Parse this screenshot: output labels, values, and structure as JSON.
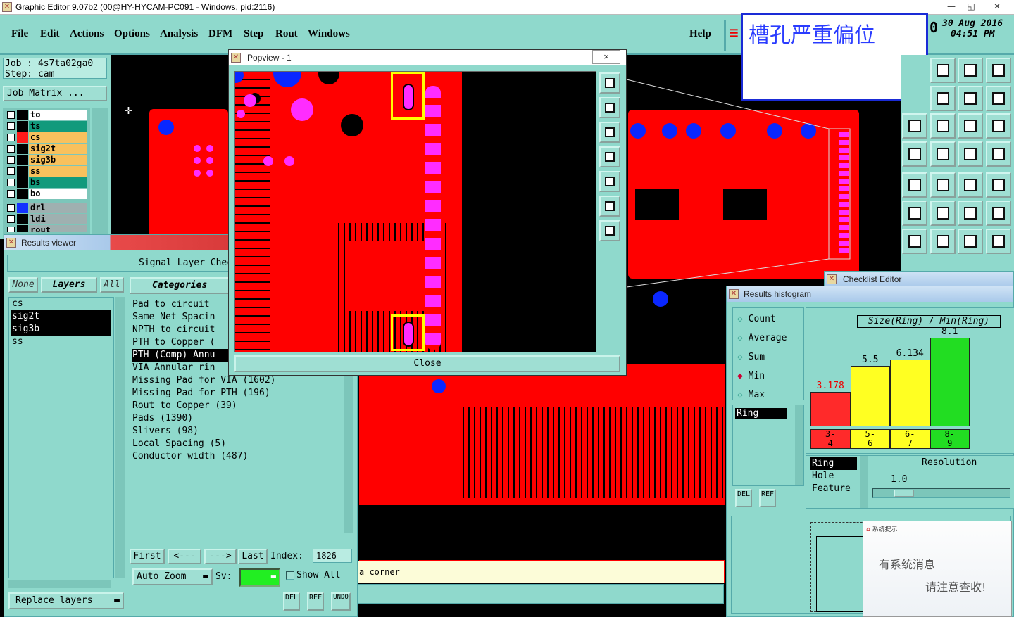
{
  "window": {
    "title": "Graphic Editor 9.07b2 (00@HY-HYCAM-PC091 - Windows, pid:2116)",
    "minimize": "—",
    "restore": "◱",
    "close": "✕"
  },
  "menu": [
    "File",
    "Edit",
    "Actions",
    "Options",
    "Analysis",
    "DFM",
    "Step",
    "Rout",
    "Windows"
  ],
  "help": "Help",
  "datetime": {
    "date": "30 Aug 2016",
    "time": "04:51 PM",
    "prefix": "0"
  },
  "annotation": {
    "text": "槽孔严重偏位"
  },
  "job": {
    "job_label": "Job : 4s7ta02ga0",
    "step_label": "Step: cam",
    "matrix_button": "Job Matrix ..."
  },
  "layers": [
    {
      "name": "to",
      "color": "#ffffff",
      "swatch": "#000000"
    },
    {
      "name": "ts",
      "color": "#129a7c",
      "swatch": "#000000"
    },
    {
      "name": "cs",
      "color": "#f8c15d",
      "swatch": "#ff1a1a"
    },
    {
      "name": "sig2t",
      "color": "#f8c15d",
      "swatch": "#000000"
    },
    {
      "name": "sig3b",
      "color": "#f8c15d",
      "swatch": "#000000"
    },
    {
      "name": "ss",
      "color": "#f8c15d",
      "swatch": "#000000"
    },
    {
      "name": "bs",
      "color": "#129a7c",
      "swatch": "#000000"
    },
    {
      "name": "bo",
      "color": "#ffffff",
      "swatch": "#000000"
    },
    {
      "name": "drl",
      "color": "#9fb0b0",
      "swatch": "#1432ff"
    },
    {
      "name": "ldi",
      "color": "#9fb0b0",
      "swatch": "#000000"
    },
    {
      "name": "rout",
      "color": "#9fb0b0",
      "swatch": "#000000"
    }
  ],
  "results_viewer": {
    "title": "Results viewer",
    "header": "Signal Layer Checks",
    "none_btn": "None",
    "layers_btn": "Layers",
    "all_btn": "All",
    "categories_label": "Categories",
    "layer_list": [
      {
        "name": "cs",
        "selected": false
      },
      {
        "name": "sig2t",
        "selected": true
      },
      {
        "name": "sig3b",
        "selected": true
      },
      {
        "name": "ss",
        "selected": false
      }
    ],
    "categories": [
      {
        "text": "Pad to circuit",
        "selected": false
      },
      {
        "text": "Same Net Spacin",
        "selected": false
      },
      {
        "text": "NPTH to circuit",
        "selected": false
      },
      {
        "text": "PTH to Copper (",
        "selected": false
      },
      {
        "text": "PTH (Comp) Annu",
        "selected": true
      },
      {
        "text": "VIA Annular rin",
        "selected": false
      },
      {
        "text": "Missing Pad for VIA (1602)",
        "selected": false
      },
      {
        "text": "Missing Pad for PTH (196)",
        "selected": false
      },
      {
        "text": "Rout to Copper (39)",
        "selected": false
      },
      {
        "text": "Pads (1390)",
        "selected": false
      },
      {
        "text": "Slivers (98)",
        "selected": false
      },
      {
        "text": "Local Spacing (5)",
        "selected": false
      },
      {
        "text": "Conductor width (487)",
        "selected": false
      }
    ],
    "first_btn": "First",
    "prev_btn": "<---",
    "next_btn": "--->",
    "last_btn": "Last",
    "index_label": "Index:",
    "index_value": "1826",
    "zoom_option": "Auto Zoom",
    "sv_label": "Sv:",
    "show_all": "Show All",
    "replace_layers": "Replace layers",
    "del": "DEL",
    "ref": "REF",
    "undo": "UNDO"
  },
  "popview": {
    "title": "Popview - 1",
    "close_btn": "Close",
    "close_x": "×"
  },
  "status": {
    "text": "a corner"
  },
  "checklist": {
    "title": "Checklist Editor"
  },
  "histogram": {
    "title": "Results histogram",
    "options": [
      {
        "label": "Count",
        "selected": false
      },
      {
        "label": "Average",
        "selected": false
      },
      {
        "label": "Sum",
        "selected": false
      },
      {
        "label": "Min",
        "selected": true
      },
      {
        "label": "Max",
        "selected": false
      }
    ],
    "measure_selected": "Ring",
    "del": "DEL",
    "ref": "REF",
    "chart_title": "Size(Ring) / Min(Ring)",
    "resolution_label": "Resolution",
    "resolution_value": "1.0",
    "attributes": [
      "Ring",
      "Hole",
      "Feature"
    ]
  },
  "chart_data": {
    "type": "bar",
    "title": "Size(Ring) / Min(Ring)",
    "categories": [
      "3-\n4",
      "5-\n6",
      "6-\n7",
      "8-\n9"
    ],
    "values": [
      3.178,
      5.5,
      6.134,
      8.1
    ],
    "value_labels": [
      "3.178",
      "5.5",
      "6.134",
      "8.1"
    ],
    "colors": [
      "#ff2a2a",
      "#ffff22",
      "#ffff22",
      "#22dd22"
    ],
    "ylim": [
      0,
      8.1
    ]
  },
  "notify": {
    "header": "系统提示",
    "line1": "有系统消息",
    "line2": "请注意查收!"
  }
}
